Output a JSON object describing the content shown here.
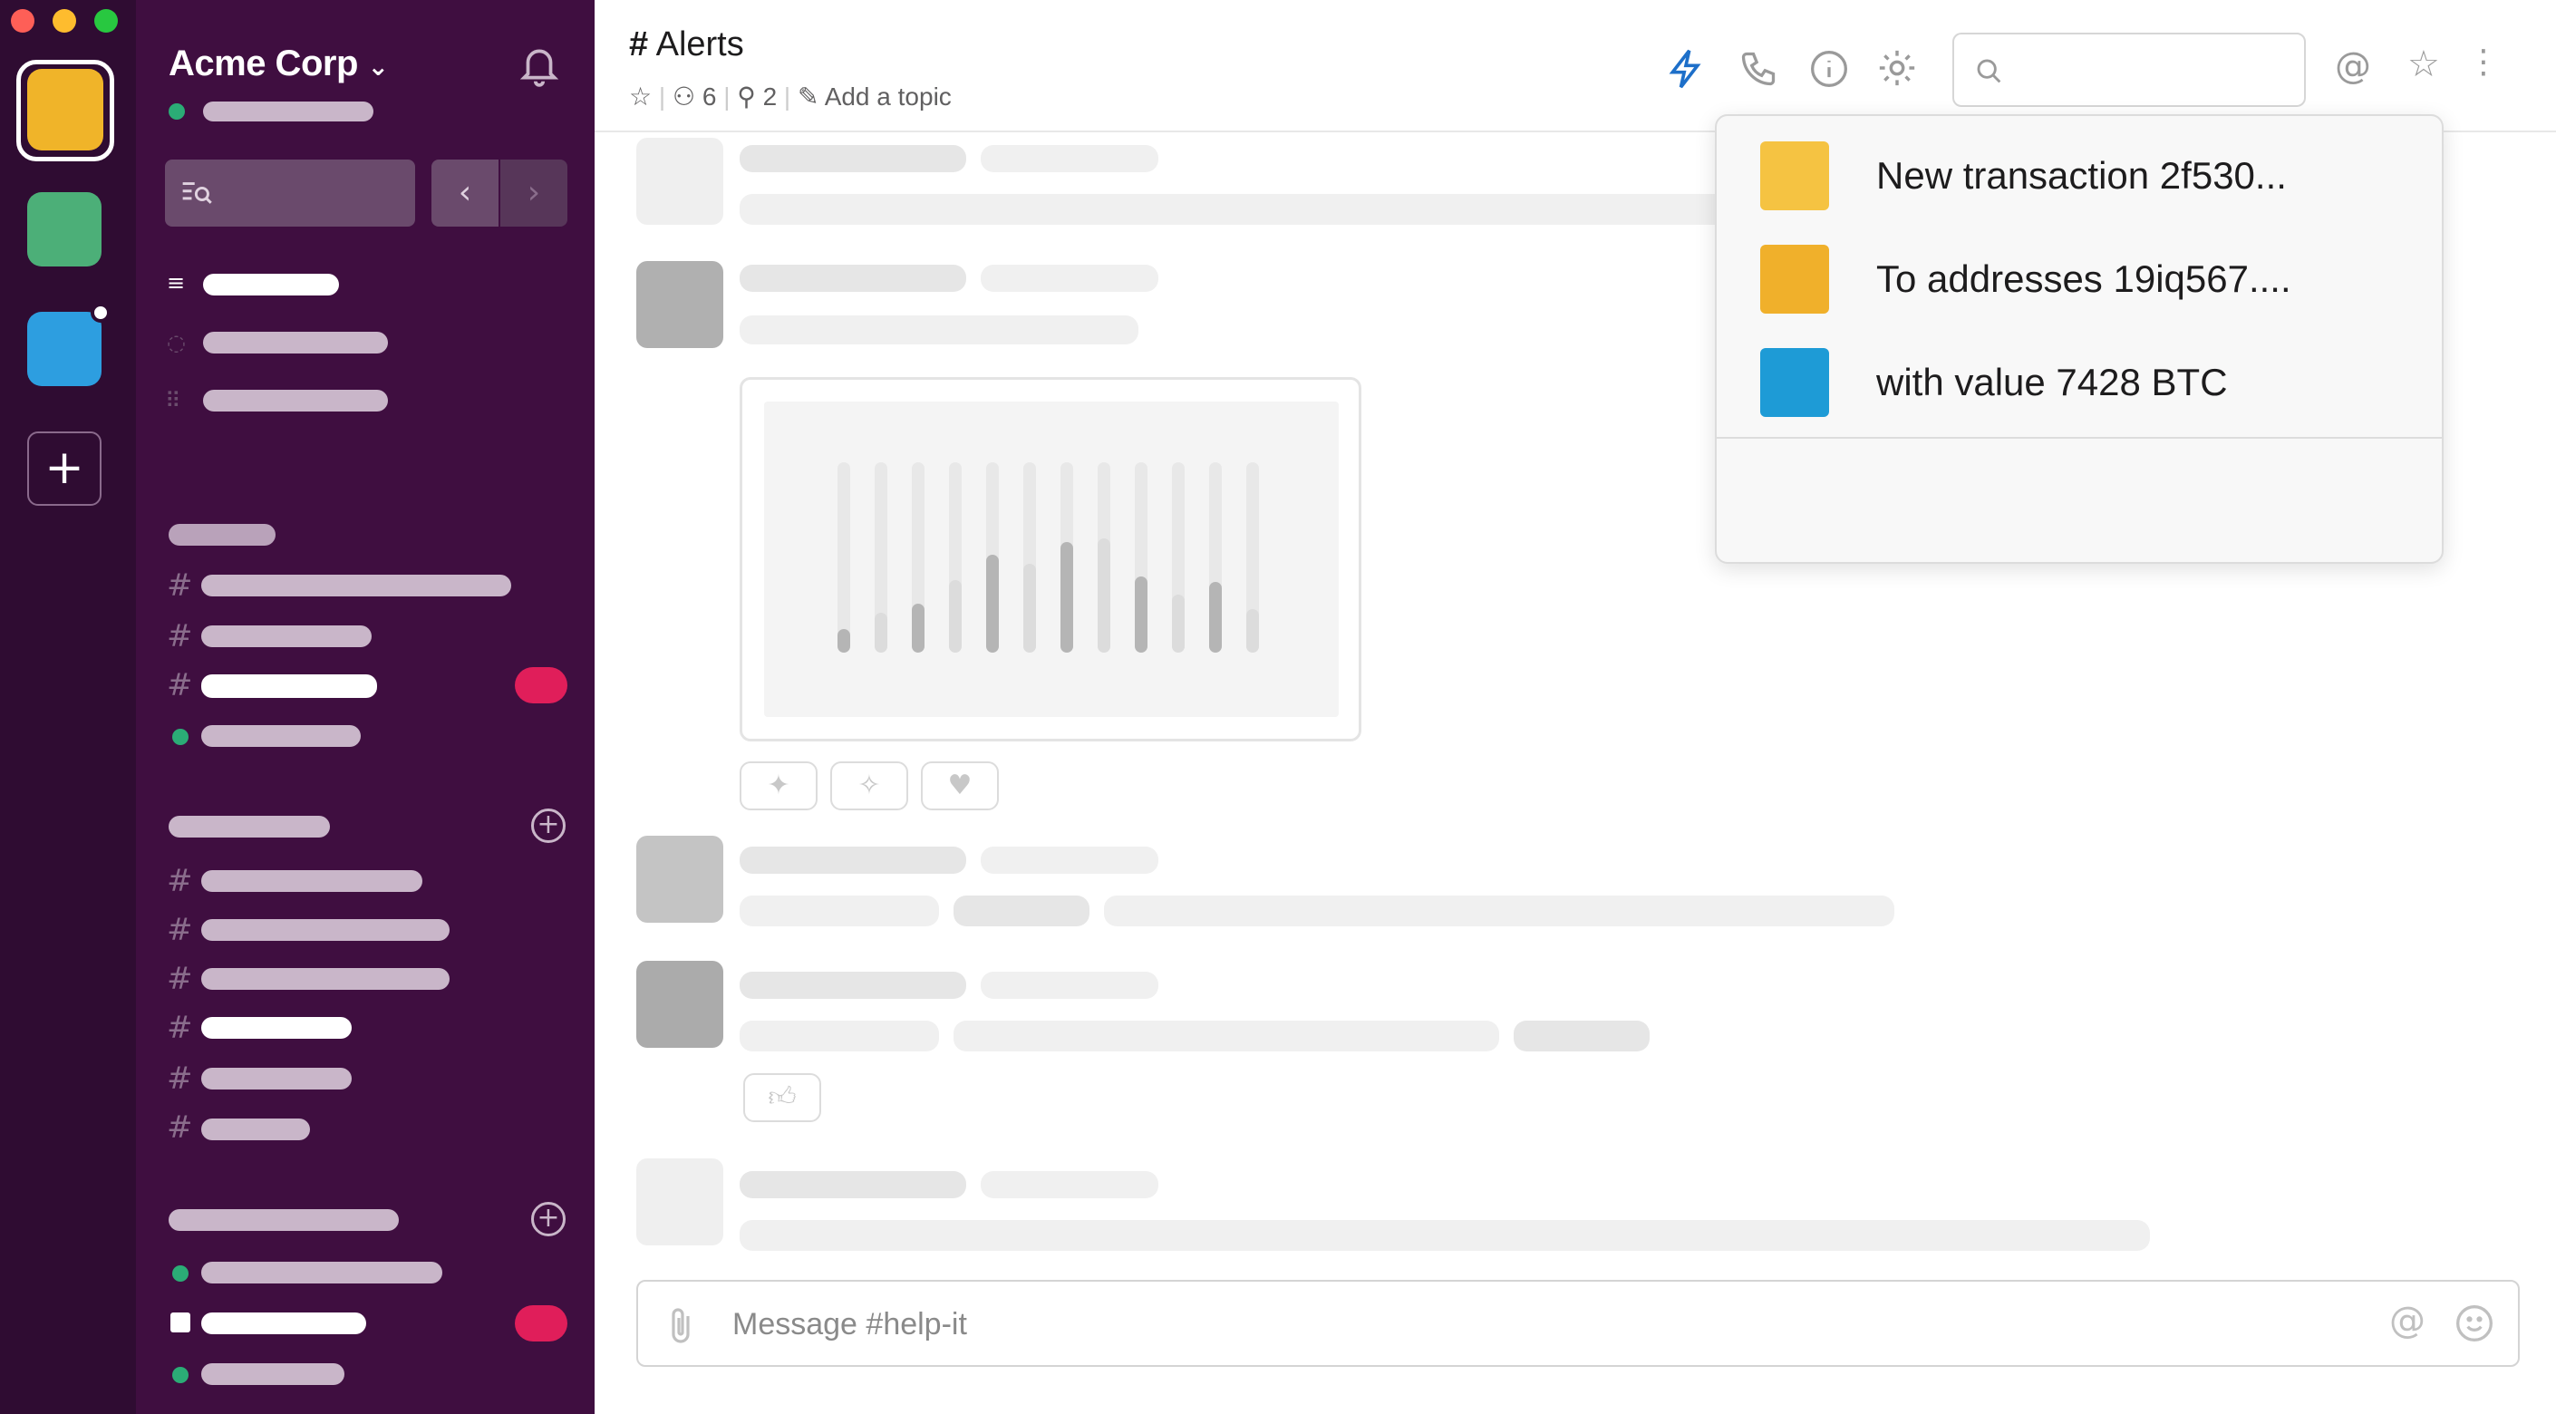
{
  "workspace": {
    "name": "Acme Corp",
    "chevron": "chevron-down-icon"
  },
  "rail": {
    "workspaces": [
      {
        "color": "#f0b429",
        "active": true
      },
      {
        "color": "#4caf78"
      },
      {
        "color": "#2d9ee0",
        "has_dot": true
      }
    ],
    "add_label": "+"
  },
  "channel": {
    "hash": "#",
    "name": "Alerts",
    "members": "6",
    "pins": "2",
    "topic": "Add a topic"
  },
  "dropdown": {
    "items": [
      {
        "label": "New transaction 2f530...",
        "color": "#f5c342"
      },
      {
        "label": "To addresses 19iq567....",
        "color": "#f0b02b"
      },
      {
        "label": "with value 7428 BTC",
        "color": "#1e9bd6"
      }
    ]
  },
  "composer": {
    "placeholder": "Message #help-it"
  },
  "colors": {
    "sidebar": "#3f0e40",
    "rail": "#2f0c32",
    "badge": "#e01e5a",
    "online": "#2bac76"
  }
}
